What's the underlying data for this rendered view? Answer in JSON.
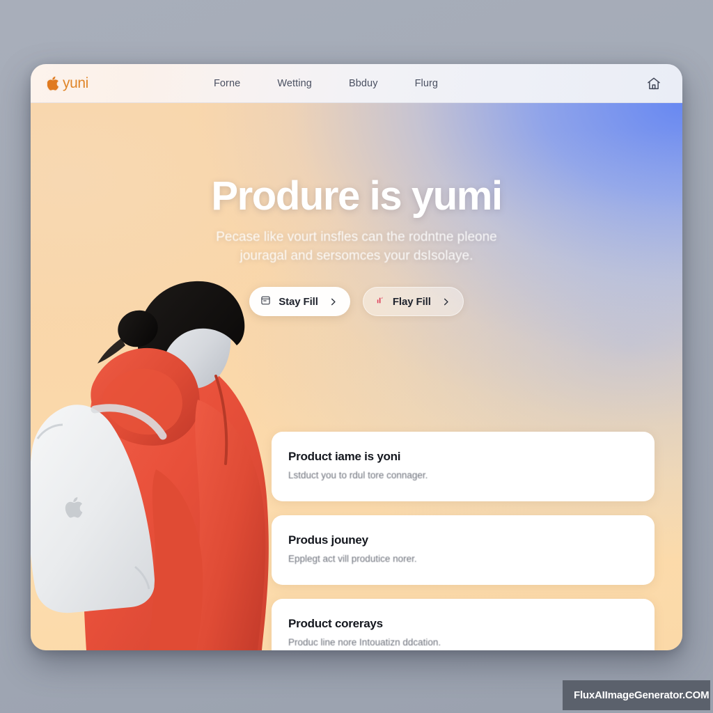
{
  "window": {
    "brand": {
      "logo_icon": "apple-logo-icon",
      "name": "yuni",
      "color": "#e0862a"
    },
    "nav": {
      "links": [
        {
          "label": "Forne"
        },
        {
          "label": "Wetting"
        },
        {
          "label": "Bbduy"
        },
        {
          "label": "Flurg"
        }
      ],
      "home_icon": "home-icon"
    }
  },
  "hero": {
    "title": "Produre is yumi",
    "subtitle": "Pecase like vourt insfles can the rodntne pleone jouragal and sersomces your dsIsolaye.",
    "buttons": [
      {
        "label": "Stay Fill",
        "icon": "document-calendar-icon",
        "chevron": "chevron-right-icon",
        "style": "primary"
      },
      {
        "label": "Flay Fill",
        "icon": "chart-spark-icon",
        "chevron": "chevron-right-icon",
        "style": "secondary",
        "icon_color": "#e0405c"
      }
    ],
    "gradient": {
      "peach": "#fbdcae",
      "blue": "#6084f5"
    },
    "illustration": {
      "subject": "person-with-backpack",
      "hoodie_color": "#e8523a",
      "backpack_color": "#eceef0",
      "backpack_logo_icon": "apple-logo-icon"
    }
  },
  "cards": [
    {
      "title": "Product iame is yoni",
      "desc": "Lstduct you to rdul tore connager."
    },
    {
      "title": "Produs jouney",
      "desc": "Epplegt act vill produtice norer."
    },
    {
      "title": "Product corerays",
      "desc": "Produc line nore Intouatizn ddcation."
    }
  ],
  "watermark": {
    "text": "FluxAIImageGenerator.COM"
  }
}
